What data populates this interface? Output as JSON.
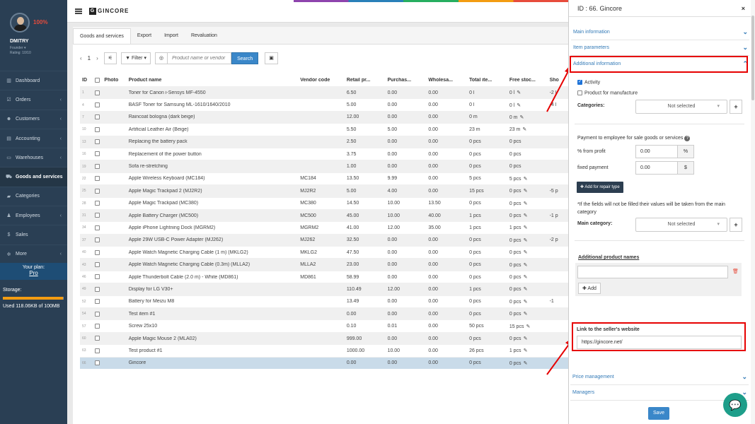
{
  "user": {
    "percent": "100%",
    "name": "DMITRY",
    "role": "Founder ▾",
    "rating": "Rating: 10/10"
  },
  "menu": [
    {
      "icon": "▥",
      "label": "Dashboard",
      "chevron": ""
    },
    {
      "icon": "☑",
      "label": "Orders",
      "chevron": "‹"
    },
    {
      "icon": "☻",
      "label": "Customers",
      "chevron": "‹"
    },
    {
      "icon": "▤",
      "label": "Accounting",
      "chevron": "‹"
    },
    {
      "icon": "▭",
      "label": "Warehouses",
      "chevron": "‹"
    },
    {
      "icon": "⛟",
      "label": "Goods and services",
      "chevron": ""
    },
    {
      "icon": "▰",
      "label": "Categories",
      "chevron": ""
    },
    {
      "icon": "♟",
      "label": "Employees",
      "chevron": "‹"
    },
    {
      "icon": "$",
      "label": "Sales",
      "chevron": ""
    },
    {
      "icon": "✲",
      "label": "More",
      "chevron": "‹"
    }
  ],
  "plan": {
    "line1": "Your plan:",
    "line2": "Pro"
  },
  "storage": {
    "label": "Storage:",
    "used_fraction": 0.99,
    "used_text": "Used 118.06KB of 100MB"
  },
  "brand": {
    "letter": "G",
    "name": "GINCORE"
  },
  "tabs": [
    "Goods and services",
    "Export",
    "Import",
    "Revaluation"
  ],
  "toolbar": {
    "prev": "‹",
    "page": "1",
    "next": "›",
    "settings_icon": "⚟",
    "filter": "▼ Filter ▾",
    "target_icon": "◎",
    "search_placeholder": "Product name or vendor",
    "search": "Search",
    "barcode_icon": "▣"
  },
  "columns": {
    "id": "ID",
    "photo": "Photo",
    "name": "Product name",
    "vendor": "Vendor code",
    "retail": "Retail pr...",
    "purchase": "Purchas...",
    "wholesale": "Wholesa...",
    "total": "Total ite...",
    "free": "Free stoc...",
    "show": "Sho"
  },
  "rows": [
    {
      "id": "1",
      "name": "Toner for Canon i-Sensys MF-4550",
      "vendor": "",
      "retail": "6.50",
      "purchase": "0.00",
      "wholesale": "0.00",
      "total": "0 l",
      "free": "0 l",
      "pen": true,
      "show": "-2 l"
    },
    {
      "id": "4",
      "name": "BASF Toner for Samsung ML-1610/1640/2010",
      "vendor": "",
      "retail": "5.00",
      "purchase": "0.00",
      "wholesale": "0.00",
      "total": "0 l",
      "free": "0 l",
      "pen": true,
      "show": "-4 l"
    },
    {
      "id": "7",
      "name": "Raincoat bologna (dark beige)",
      "vendor": "",
      "retail": "12.00",
      "purchase": "0.00",
      "wholesale": "0.00",
      "total": "0 m",
      "free": "0 m",
      "pen": true,
      "show": ""
    },
    {
      "id": "10",
      "name": "Artificial Leather Air (Beige)",
      "vendor": "",
      "retail": "5.50",
      "purchase": "5.00",
      "wholesale": "0.00",
      "total": "23 m",
      "free": "23 m",
      "pen": true,
      "show": ""
    },
    {
      "id": "13",
      "name": "Replacing the battery pack",
      "vendor": "",
      "retail": "2.50",
      "purchase": "0.00",
      "wholesale": "0.00",
      "total": "0 pcs",
      "free": "0 pcs",
      "pen": false,
      "show": ""
    },
    {
      "id": "16",
      "name": "Replacement of the power button",
      "vendor": "",
      "retail": "3.75",
      "purchase": "0.00",
      "wholesale": "0.00",
      "total": "0 pcs",
      "free": "0 pcs",
      "pen": false,
      "show": ""
    },
    {
      "id": "19",
      "name": "Sofa re-stretching",
      "vendor": "",
      "retail": "1.00",
      "purchase": "0.00",
      "wholesale": "0.00",
      "total": "0 pcs",
      "free": "0 pcs",
      "pen": false,
      "show": ""
    },
    {
      "id": "22",
      "name": "Apple Wireless Keyboard (MC184)",
      "vendor": "MC184",
      "retail": "13.50",
      "purchase": "9.99",
      "wholesale": "0.00",
      "total": "5 pcs",
      "free": "5 pcs",
      "pen": true,
      "show": ""
    },
    {
      "id": "25",
      "name": "Apple Magic Trackpad 2 (MJ2R2)",
      "vendor": "MJ2R2",
      "retail": "5.00",
      "purchase": "4.00",
      "wholesale": "0.00",
      "total": "15 pcs",
      "free": "0 pcs",
      "pen": true,
      "show": "-5 p"
    },
    {
      "id": "28",
      "name": "Apple Magic Trackpad (MC380)",
      "vendor": "MC380",
      "retail": "14.50",
      "purchase": "10.00",
      "wholesale": "13.50",
      "total": "0 pcs",
      "free": "0 pcs",
      "pen": true,
      "show": ""
    },
    {
      "id": "31",
      "name": "Apple Battery Charger (MC500)",
      "vendor": "MC500",
      "retail": "45.00",
      "purchase": "10.00",
      "wholesale": "40.00",
      "total": "1 pcs",
      "free": "0 pcs",
      "pen": true,
      "show": "-1 p"
    },
    {
      "id": "34",
      "name": "Apple iPhone Lightning Dock (MGRM2)",
      "vendor": "MGRM2",
      "retail": "41.00",
      "purchase": "12.00",
      "wholesale": "35.00",
      "total": "1 pcs",
      "free": "1 pcs",
      "pen": true,
      "show": ""
    },
    {
      "id": "37",
      "name": "Apple 29W USB-C Power Adapter (MJ262)",
      "vendor": "MJ262",
      "retail": "32.50",
      "purchase": "0.00",
      "wholesale": "0.00",
      "total": "0 pcs",
      "free": "0 pcs",
      "pen": true,
      "show": "-2 p"
    },
    {
      "id": "40",
      "name": "Apple Watch Magnetic Charging Cable (1 m) (MKLG2)",
      "vendor": "MKLG2",
      "retail": "47.50",
      "purchase": "0.00",
      "wholesale": "0.00",
      "total": "0 pcs",
      "free": "0 pcs",
      "pen": true,
      "show": ""
    },
    {
      "id": "43",
      "name": "Apple Watch Magnetic Charging Cable (0.3m) (MLLA2)",
      "vendor": "MLLA2",
      "retail": "23.00",
      "purchase": "0.00",
      "wholesale": "0.00",
      "total": "0 pcs",
      "free": "0 pcs",
      "pen": true,
      "show": ""
    },
    {
      "id": "46",
      "name": "Apple Thunderbolt Cable (2.0 m) - White (MD861)",
      "vendor": "MD861",
      "retail": "58.99",
      "purchase": "0.00",
      "wholesale": "0.00",
      "total": "0 pcs",
      "free": "0 pcs",
      "pen": true,
      "show": ""
    },
    {
      "id": "49",
      "name": "Display for LG V30+",
      "vendor": "",
      "retail": "110.49",
      "purchase": "12.00",
      "wholesale": "0.00",
      "total": "1 pcs",
      "free": "0 pcs",
      "pen": true,
      "show": ""
    },
    {
      "id": "52",
      "name": "Battery for Meizu M8",
      "vendor": "",
      "retail": "13.49",
      "purchase": "0.00",
      "wholesale": "0.00",
      "total": "0 pcs",
      "free": "0 pcs",
      "pen": true,
      "show": "-1"
    },
    {
      "id": "54",
      "name": "Test item #1",
      "vendor": "",
      "retail": "0.00",
      "purchase": "0.00",
      "wholesale": "0.00",
      "total": "0 pcs",
      "free": "0 pcs",
      "pen": true,
      "show": ""
    },
    {
      "id": "57",
      "name": "Screw 25x10",
      "vendor": "",
      "retail": "0.10",
      "purchase": "0.01",
      "wholesale": "0.00",
      "total": "50 pcs",
      "free": "15 pcs",
      "pen": true,
      "show": ""
    },
    {
      "id": "60",
      "name": "Apple Magic Mouse 2 (MLA02)",
      "vendor": "",
      "retail": "999.00",
      "purchase": "0.00",
      "wholesale": "0.00",
      "total": "0 pcs",
      "free": "0 pcs",
      "pen": true,
      "show": ""
    },
    {
      "id": "63",
      "name": "Test product #1",
      "vendor": "",
      "retail": "1000.00",
      "purchase": "10.00",
      "wholesale": "0.00",
      "total": "26 pcs",
      "free": "1 pcs",
      "pen": true,
      "show": ""
    },
    {
      "id": "66",
      "name": "Gincore",
      "vendor": "",
      "retail": "0.00",
      "purchase": "0.00",
      "wholesale": "0.00",
      "total": "0 pcs",
      "free": "0 pcs",
      "pen": true,
      "show": ""
    }
  ],
  "drawer": {
    "title": "ID : 66. Gincore",
    "close": "×",
    "sections": {
      "main": "Main information",
      "params": "Item parameters",
      "additional": "Additional information",
      "price": "Price management",
      "managers": "Managers"
    },
    "chevron_down": "⌄",
    "chevron_up": "⌃",
    "activity": "Activity",
    "manufacture": "Product for manufacture",
    "categories_label": "Categories:",
    "not_selected": "Not selected",
    "dd": "▾",
    "plus": "+",
    "payment_label": "Payment to employee for sale goods or services",
    "help": "?",
    "pct_profit_label": "% from profit",
    "pct_profit_value": "0.00",
    "pct_unit": "%",
    "fixed_label": "fixed payment",
    "fixed_value": "0.00",
    "fixed_unit": "$",
    "add_repair": "✚ Add for repair type",
    "note": "*If the fields will not be filled their values will be taken from the main category",
    "main_category_label": "Main category:",
    "apn_label": "Additional product names",
    "trash": "🗑",
    "add": "✚ Add",
    "link_label": "Link to the seller's website",
    "link_value": "https://gincore.net/",
    "save": "Save"
  },
  "chat_icon": "💬",
  "colors": {
    "sidebar": "#2a3f54",
    "accent": "#3a87c9",
    "highlight": "#e60000"
  }
}
